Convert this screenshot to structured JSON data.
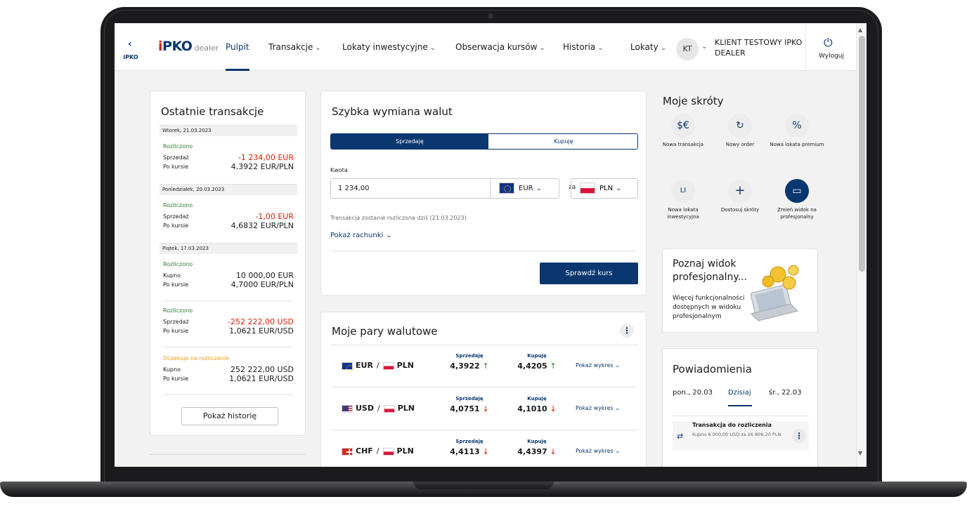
{
  "header": {
    "back_label": "iPKO",
    "back_icon": "chevron-left-icon",
    "logo_i": "i",
    "logo_pko": "PKO",
    "logo_dealer": "dealer",
    "nav": [
      "Pulpit",
      "Transakcje",
      "Lokaty inwestycyjne",
      "Obserwacja kursów",
      "Historia",
      "Lokaty"
    ],
    "active_nav": "Pulpit",
    "user_initials": "KT",
    "user_name": "KLIENT TESTOWY IPKO DEALER",
    "logout_label": "Wyloguj"
  },
  "recent": {
    "title": "Ostatnie transakcje",
    "groups": [
      {
        "date": "Wtorek, 21.03.2023",
        "transactions": [
          {
            "status": "Rozliczono",
            "kind": "Sprzedaż",
            "amount": "-1 234,00 EUR",
            "rate_label": "Po kursie",
            "rate": "4,3922 EUR/PLN"
          }
        ]
      },
      {
        "date": "Poniedziałek, 20.03.2023",
        "transactions": [
          {
            "status": "Rozliczono",
            "kind": "Sprzedaż",
            "amount": "-1,00 EUR",
            "rate_label": "Po kursie",
            "rate": "4,6832 EUR/PLN"
          }
        ]
      },
      {
        "date": "Piątek, 17.03.2023",
        "transactions": [
          {
            "status": "Rozliczono",
            "kind": "Kupno",
            "amount": "10 000,00 EUR",
            "rate_label": "Po kursie",
            "rate": "4,7000 EUR/PLN"
          },
          {
            "status": "Rozliczono",
            "kind": "Sprzedaż",
            "amount": "-252 222,00 USD",
            "rate_label": "Po kursie",
            "rate": "1,0621 EUR/USD"
          },
          {
            "status": "Oczekuje na rozliczenie",
            "kind": "Kupno",
            "amount": "252 222,00 USD",
            "rate_label": "Po kursie",
            "rate": "1,0621 EUR/USD"
          }
        ]
      }
    ],
    "history_button": "Pokaż historię"
  },
  "exchange": {
    "title": "Szybka wymiana walut",
    "sell_label": "Sprzedaję",
    "buy_label": "Kupuję",
    "amount_label": "Kwota",
    "amount_value": "1 234,00",
    "from_currency": "EUR",
    "za": "za",
    "to_currency": "PLN",
    "note": "Transakcja zostanie rozliczona dziś (21.03.2023)",
    "show_accounts": "Pokaż rachunki",
    "check_button": "Sprawdź kurs"
  },
  "pairs": {
    "title": "Moje pary walutowe",
    "sell_header": "Sprzedaję",
    "buy_header": "Kupuję",
    "chart_link": "Pokaż wykres",
    "rows": [
      {
        "base": "EUR",
        "quote": "PLN",
        "sell": "4,3922",
        "buy": "4,4205",
        "trend": "up"
      },
      {
        "base": "USD",
        "quote": "PLN",
        "sell": "4,0751",
        "buy": "4,1010",
        "trend": "down"
      },
      {
        "base": "CHF",
        "quote": "PLN",
        "sell": "4,4113",
        "buy": "4,4397",
        "trend": "down"
      }
    ]
  },
  "shortcuts": {
    "title": "Moje skróty",
    "items": [
      {
        "label": "Nowa transakcja",
        "icon": "currency-exchange-icon",
        "glyph": "$€"
      },
      {
        "label": "Nowy order",
        "icon": "order-icon",
        "glyph": "↻"
      },
      {
        "label": "Nowa lokata premium",
        "icon": "percent-star-icon",
        "glyph": "%"
      },
      {
        "label": "Nowa lokata inwestycyjna",
        "icon": "investment-deposit-icon",
        "glyph": "LI"
      },
      {
        "label": "Dostosuj skróty",
        "icon": "plus-icon",
        "glyph": "+"
      },
      {
        "label": "Zmień widok na profesjonalny",
        "icon": "monitor-icon",
        "glyph": "▭"
      }
    ]
  },
  "promo": {
    "title": "Poznaj widok profesjonalny...",
    "text": "Więcej funkcjonalności dostępnych w widoku profesjonalnym"
  },
  "notifications": {
    "title": "Powiadomienia",
    "tabs": [
      "pon., 20.03",
      "Dzisiaj",
      "śr., 22.03"
    ],
    "active_tab": "Dzisiaj",
    "items": [
      {
        "title": "Transakcja do rozliczenia",
        "desc": "Kupno 6 000,00 USD za 26 806,20 PLN",
        "icon": "exchange-icon"
      }
    ]
  },
  "colors": {
    "brand": "#0a3770",
    "negative": "#d81e05",
    "positive": "#2e7d32",
    "pending": "#f39c12"
  }
}
